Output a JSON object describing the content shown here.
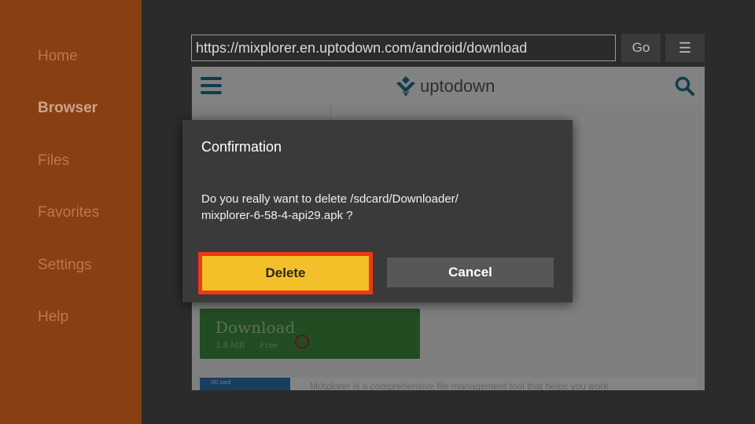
{
  "sidebar": {
    "items": [
      {
        "label": "Home"
      },
      {
        "label": "Browser"
      },
      {
        "label": "Files"
      },
      {
        "label": "Favorites"
      },
      {
        "label": "Settings"
      },
      {
        "label": "Help"
      }
    ],
    "active": "Browser"
  },
  "toolbar": {
    "url": "https://mixplorer.en.uptodown.com/android/download",
    "go_label": "Go",
    "menu_icon": "menu-icon"
  },
  "webpage": {
    "logo_text": "uptodown",
    "download": {
      "label": "Download",
      "size": "3.8 MB",
      "price": "Free"
    },
    "card": {
      "thumb_text": "SD card",
      "description": "MiXplorer is a comprehensive file management tool that helps you work"
    }
  },
  "dialog": {
    "title": "Confirmation",
    "message_line1": "Do you really want to delete /sdcard/Downloader/",
    "message_line2": "mixplorer-6-58-4-api29.apk ?",
    "delete_label": "Delete",
    "cancel_label": "Cancel"
  },
  "colors": {
    "sidebar_bg": "#8a3f12",
    "highlight_border": "#ee3818",
    "delete_bg": "#f4bf23",
    "download_bg": "#3f8a3f",
    "brand_blue": "#1d6f8e"
  }
}
